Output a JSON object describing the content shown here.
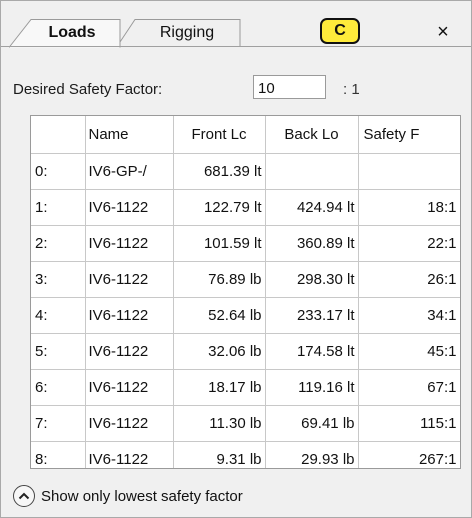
{
  "tabs": [
    {
      "label": "Loads",
      "active": true
    },
    {
      "label": "Rigging",
      "active": false
    }
  ],
  "badge": "C",
  "close_glyph": "×",
  "safety": {
    "label": "Desired Safety Factor:",
    "value": "10",
    "ratio": ": 1"
  },
  "table": {
    "columns": [
      "",
      "Name",
      "Front Lc",
      "Back Lo",
      "Safety F"
    ],
    "rows": [
      [
        "0:",
        "IV6-GP-/",
        "681.39 lt",
        "",
        ""
      ],
      [
        "1:",
        "IV6-1122",
        "122.79 lt",
        "424.94 lt",
        "18:1"
      ],
      [
        "2:",
        "IV6-1122",
        "101.59 lt",
        "360.89 lt",
        "22:1"
      ],
      [
        "3:",
        "IV6-1122",
        "76.89 lb",
        "298.30 lt",
        "26:1"
      ],
      [
        "4:",
        "IV6-1122",
        "52.64 lb",
        "233.17 lt",
        "34:1"
      ],
      [
        "5:",
        "IV6-1122",
        "32.06 lb",
        "174.58 lt",
        "45:1"
      ],
      [
        "6:",
        "IV6-1122",
        "18.17 lb",
        "119.16 lt",
        "67:1"
      ],
      [
        "7:",
        "IV6-1122",
        "11.30 lb",
        "69.41 lb",
        "115:1"
      ],
      [
        "8:",
        "IV6-1122",
        "9.31 lb",
        "29.93 lb",
        "267:1"
      ]
    ]
  },
  "footer": {
    "icon": "chevron-up-circle-icon",
    "label": "Show only lowest safety factor"
  }
}
